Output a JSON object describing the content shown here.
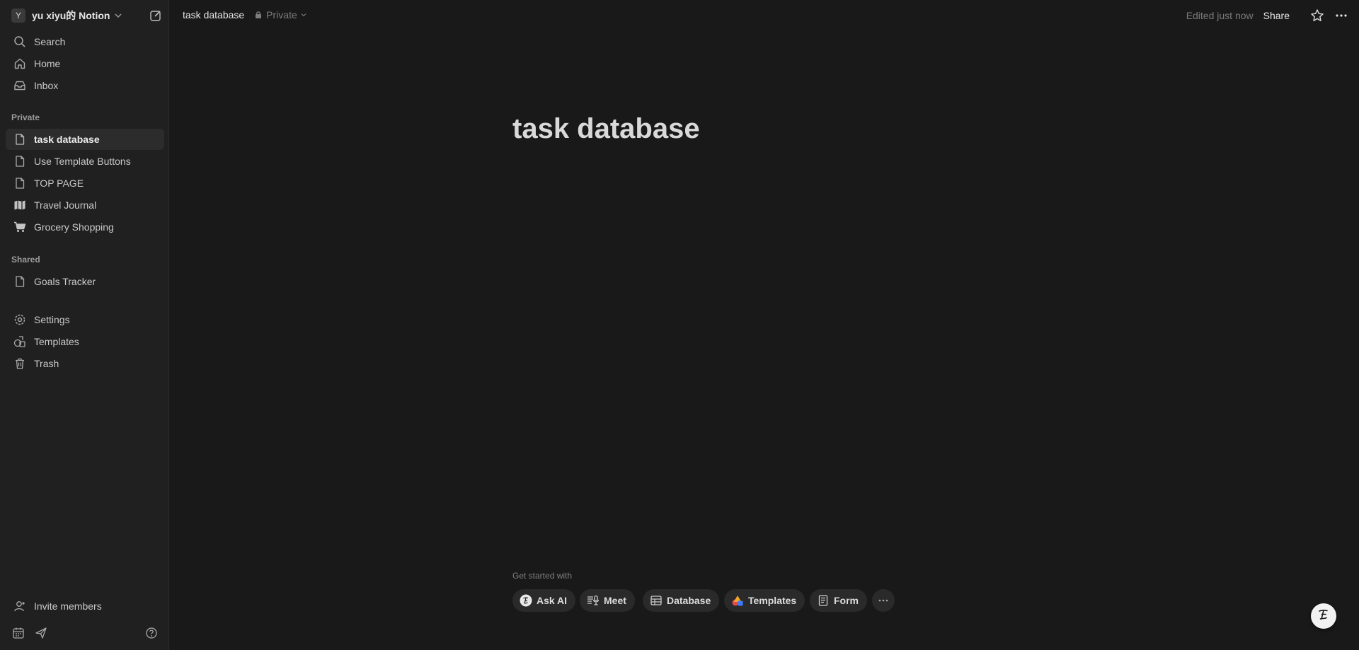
{
  "workspace": {
    "avatar_letter": "Y",
    "name": "yu xiyu的 Notion"
  },
  "sidebar": {
    "top_items": [
      {
        "label": "Search",
        "icon": "search-icon"
      },
      {
        "label": "Home",
        "icon": "home-icon"
      },
      {
        "label": "Inbox",
        "icon": "inbox-icon"
      }
    ],
    "private_label": "Private",
    "private_items": [
      {
        "label": "task database",
        "icon": "page-icon",
        "active": true
      },
      {
        "label": "Use Template Buttons",
        "icon": "page-icon"
      },
      {
        "label": "TOP PAGE",
        "icon": "page-icon"
      },
      {
        "label": "Travel Journal",
        "icon": "map-icon"
      },
      {
        "label": "Grocery Shopping",
        "icon": "cart-icon"
      }
    ],
    "shared_label": "Shared",
    "shared_items": [
      {
        "label": "Goals Tracker",
        "icon": "page-icon"
      }
    ],
    "util_items": [
      {
        "label": "Settings",
        "icon": "gear-icon"
      },
      {
        "label": "Templates",
        "icon": "templates-icon"
      },
      {
        "label": "Trash",
        "icon": "trash-icon"
      }
    ],
    "invite_label": "Invite members"
  },
  "topbar": {
    "breadcrumb_title": "task database",
    "privacy_label": "Private",
    "edited_label": "Edited just now",
    "share_label": "Share"
  },
  "page": {
    "title": "task database",
    "get_started_label": "Get started with",
    "chips": [
      {
        "label": "Ask AI",
        "icon": "notion-ai-icon"
      },
      {
        "label": "Meet",
        "icon": "meet-icon"
      },
      {
        "label": "Database",
        "icon": "table-icon"
      },
      {
        "label": "Templates",
        "icon": "templates-color-icon"
      },
      {
        "label": "Form",
        "icon": "form-icon"
      }
    ]
  },
  "colors": {
    "background": "#191919",
    "sidebar": "#202020",
    "chip": "#2a2a2a",
    "active_item": "#2c2c2c"
  }
}
